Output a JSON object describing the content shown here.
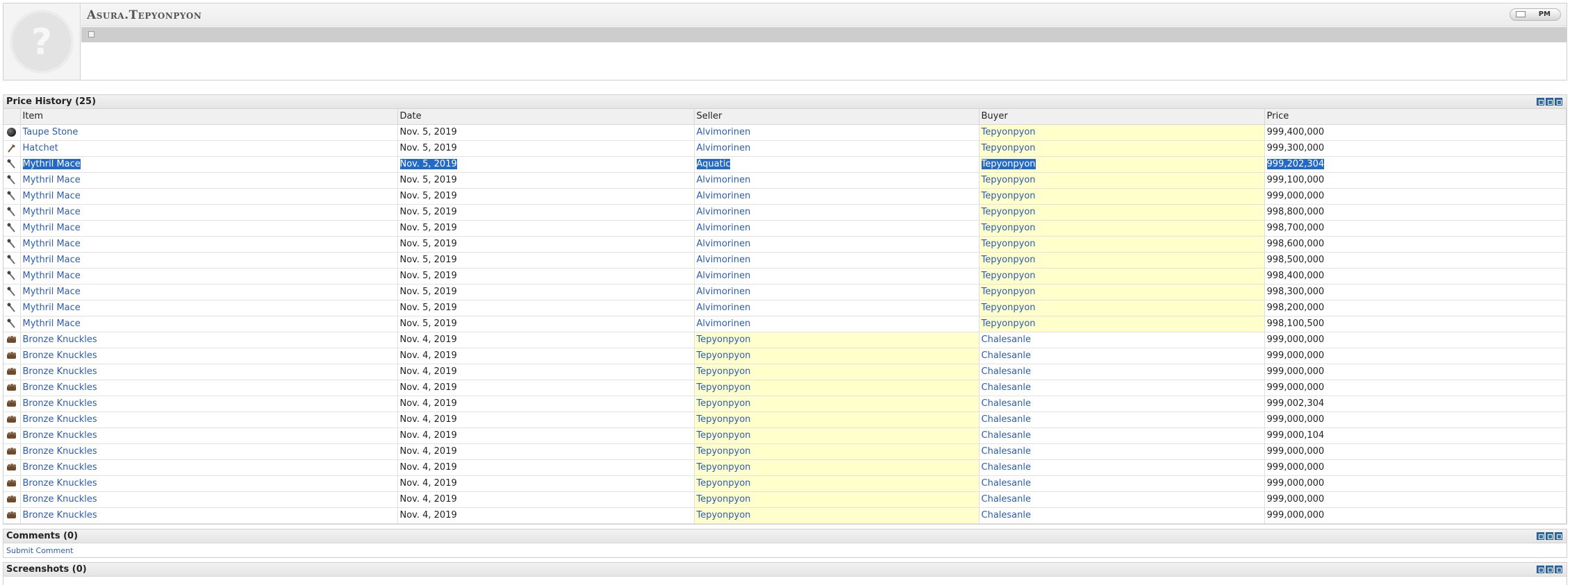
{
  "profile": {
    "name": "Asura.Tepyonpyon",
    "pm_label": "PM"
  },
  "price_history": {
    "title": "Price History (25)",
    "columns": [
      "Item",
      "Date",
      "Seller",
      "Buyer",
      "Price"
    ],
    "rows": [
      {
        "icon": "stone-icon",
        "item": "Taupe Stone",
        "date": "Nov. 5, 2019",
        "seller": "Alvimorinen",
        "buyer": "Tepyonpyon",
        "price": "999,400,000",
        "hl": "buyer"
      },
      {
        "icon": "hatchet-icon",
        "item": "Hatchet",
        "date": "Nov. 5, 2019",
        "seller": "Alvimorinen",
        "buyer": "Tepyonpyon",
        "price": "999,300,000",
        "hl": "buyer"
      },
      {
        "icon": "mace-icon",
        "item": "Mythril Mace",
        "date": "Nov. 5, 2019",
        "seller": "Aquatic",
        "buyer": "Tepyonpyon",
        "price": "999,202,304",
        "hl": "buyer",
        "selected": true
      },
      {
        "icon": "mace-icon",
        "item": "Mythril Mace",
        "date": "Nov. 5, 2019",
        "seller": "Alvimorinen",
        "buyer": "Tepyonpyon",
        "price": "999,100,000",
        "hl": "buyer"
      },
      {
        "icon": "mace-icon",
        "item": "Mythril Mace",
        "date": "Nov. 5, 2019",
        "seller": "Alvimorinen",
        "buyer": "Tepyonpyon",
        "price": "999,000,000",
        "hl": "buyer"
      },
      {
        "icon": "mace-icon",
        "item": "Mythril Mace",
        "date": "Nov. 5, 2019",
        "seller": "Alvimorinen",
        "buyer": "Tepyonpyon",
        "price": "998,800,000",
        "hl": "buyer"
      },
      {
        "icon": "mace-icon",
        "item": "Mythril Mace",
        "date": "Nov. 5, 2019",
        "seller": "Alvimorinen",
        "buyer": "Tepyonpyon",
        "price": "998,700,000",
        "hl": "buyer"
      },
      {
        "icon": "mace-icon",
        "item": "Mythril Mace",
        "date": "Nov. 5, 2019",
        "seller": "Alvimorinen",
        "buyer": "Tepyonpyon",
        "price": "998,600,000",
        "hl": "buyer"
      },
      {
        "icon": "mace-icon",
        "item": "Mythril Mace",
        "date": "Nov. 5, 2019",
        "seller": "Alvimorinen",
        "buyer": "Tepyonpyon",
        "price": "998,500,000",
        "hl": "buyer"
      },
      {
        "icon": "mace-icon",
        "item": "Mythril Mace",
        "date": "Nov. 5, 2019",
        "seller": "Alvimorinen",
        "buyer": "Tepyonpyon",
        "price": "998,400,000",
        "hl": "buyer"
      },
      {
        "icon": "mace-icon",
        "item": "Mythril Mace",
        "date": "Nov. 5, 2019",
        "seller": "Alvimorinen",
        "buyer": "Tepyonpyon",
        "price": "998,300,000",
        "hl": "buyer"
      },
      {
        "icon": "mace-icon",
        "item": "Mythril Mace",
        "date": "Nov. 5, 2019",
        "seller": "Alvimorinen",
        "buyer": "Tepyonpyon",
        "price": "998,200,000",
        "hl": "buyer"
      },
      {
        "icon": "mace-icon",
        "item": "Mythril Mace",
        "date": "Nov. 5, 2019",
        "seller": "Alvimorinen",
        "buyer": "Tepyonpyon",
        "price": "998,100,500",
        "hl": "buyer"
      },
      {
        "icon": "knuckles-icon",
        "item": "Bronze Knuckles",
        "date": "Nov. 4, 2019",
        "seller": "Tepyonpyon",
        "buyer": "Chalesanle",
        "price": "999,000,000",
        "hl": "seller"
      },
      {
        "icon": "knuckles-icon",
        "item": "Bronze Knuckles",
        "date": "Nov. 4, 2019",
        "seller": "Tepyonpyon",
        "buyer": "Chalesanle",
        "price": "999,000,000",
        "hl": "seller"
      },
      {
        "icon": "knuckles-icon",
        "item": "Bronze Knuckles",
        "date": "Nov. 4, 2019",
        "seller": "Tepyonpyon",
        "buyer": "Chalesanle",
        "price": "999,000,000",
        "hl": "seller"
      },
      {
        "icon": "knuckles-icon",
        "item": "Bronze Knuckles",
        "date": "Nov. 4, 2019",
        "seller": "Tepyonpyon",
        "buyer": "Chalesanle",
        "price": "999,000,000",
        "hl": "seller"
      },
      {
        "icon": "knuckles-icon",
        "item": "Bronze Knuckles",
        "date": "Nov. 4, 2019",
        "seller": "Tepyonpyon",
        "buyer": "Chalesanle",
        "price": "999,002,304",
        "hl": "seller"
      },
      {
        "icon": "knuckles-icon",
        "item": "Bronze Knuckles",
        "date": "Nov. 4, 2019",
        "seller": "Tepyonpyon",
        "buyer": "Chalesanle",
        "price": "999,000,000",
        "hl": "seller"
      },
      {
        "icon": "knuckles-icon",
        "item": "Bronze Knuckles",
        "date": "Nov. 4, 2019",
        "seller": "Tepyonpyon",
        "buyer": "Chalesanle",
        "price": "999,000,104",
        "hl": "seller"
      },
      {
        "icon": "knuckles-icon",
        "item": "Bronze Knuckles",
        "date": "Nov. 4, 2019",
        "seller": "Tepyonpyon",
        "buyer": "Chalesanle",
        "price": "999,000,000",
        "hl": "seller"
      },
      {
        "icon": "knuckles-icon",
        "item": "Bronze Knuckles",
        "date": "Nov. 4, 2019",
        "seller": "Tepyonpyon",
        "buyer": "Chalesanle",
        "price": "999,000,000",
        "hl": "seller"
      },
      {
        "icon": "knuckles-icon",
        "item": "Bronze Knuckles",
        "date": "Nov. 4, 2019",
        "seller": "Tepyonpyon",
        "buyer": "Chalesanle",
        "price": "999,000,000",
        "hl": "seller"
      },
      {
        "icon": "knuckles-icon",
        "item": "Bronze Knuckles",
        "date": "Nov. 4, 2019",
        "seller": "Tepyonpyon",
        "buyer": "Chalesanle",
        "price": "999,000,000",
        "hl": "seller"
      },
      {
        "icon": "knuckles-icon",
        "item": "Bronze Knuckles",
        "date": "Nov. 4, 2019",
        "seller": "Tepyonpyon",
        "buyer": "Chalesanle",
        "price": "999,000,000",
        "hl": "seller"
      }
    ]
  },
  "comments": {
    "title": "Comments (0)",
    "submit_label": "Submit Comment"
  },
  "screenshots": {
    "title": "Screenshots (0)"
  },
  "colors": {
    "link": "#2a5db0",
    "highlight": "#ffffcc",
    "selection": "#2469c5",
    "control": "#2f6fb3"
  }
}
